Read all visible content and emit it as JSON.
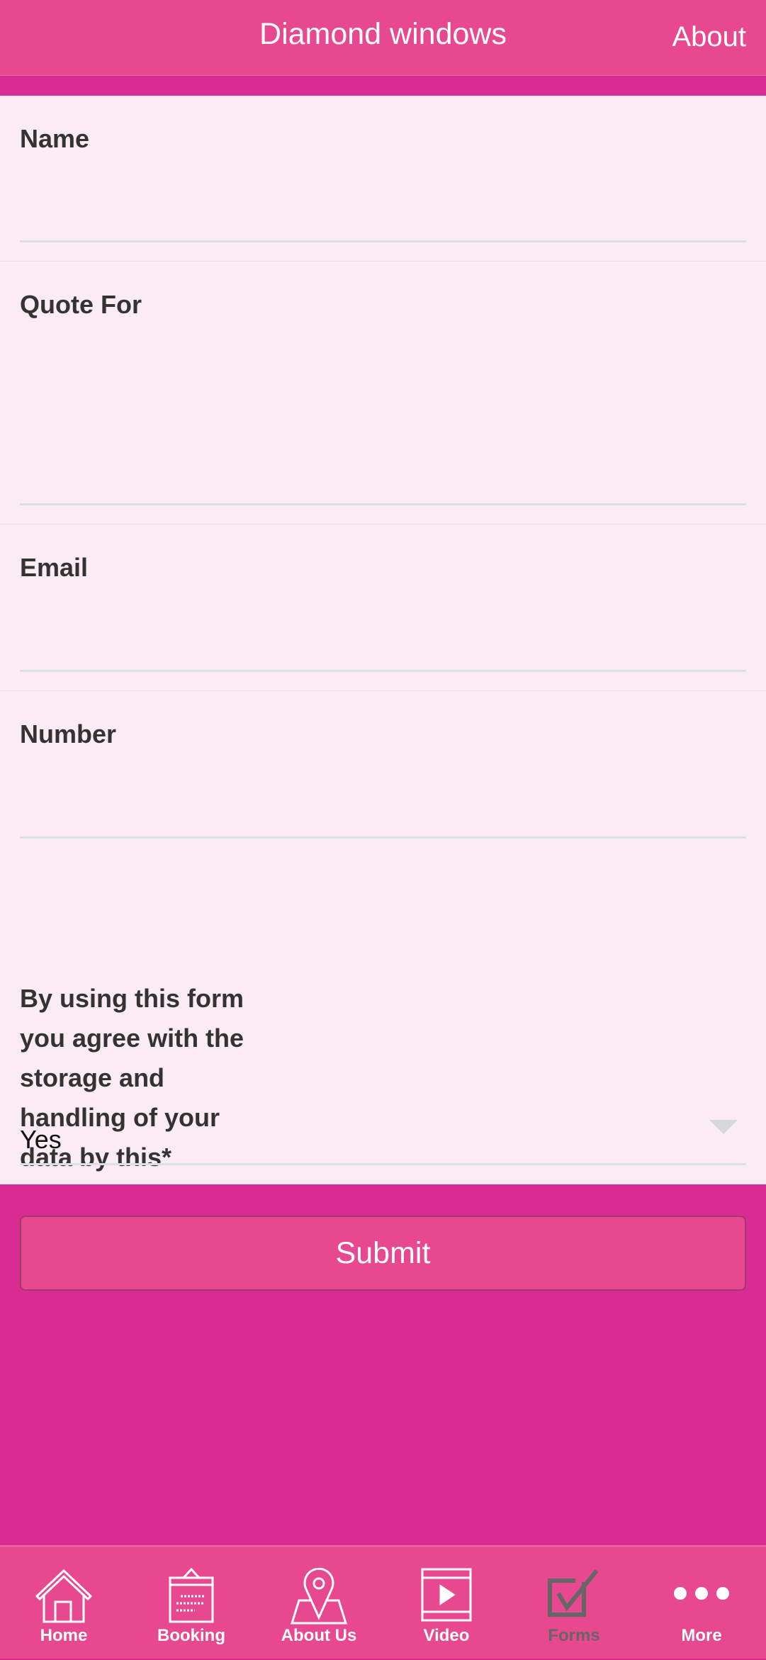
{
  "header": {
    "title": "Diamond windows",
    "about_label": "About"
  },
  "form": {
    "fields": [
      {
        "label": "Name",
        "value": ""
      },
      {
        "label": "Quote For",
        "value": ""
      },
      {
        "label": "Email",
        "value": ""
      },
      {
        "label": "Number",
        "value": ""
      }
    ],
    "consent_label": "By using this form you agree with the storage and handling of your data by this*",
    "consent_value": "Yes",
    "submit_label": "Submit"
  },
  "tabs": [
    {
      "label": "Home",
      "icon": "home-icon"
    },
    {
      "label": "Booking",
      "icon": "calendar-icon"
    },
    {
      "label": "About Us",
      "icon": "map-pin-icon"
    },
    {
      "label": "Video",
      "icon": "video-icon"
    },
    {
      "label": "Forms",
      "icon": "checkbox-icon",
      "active": true
    },
    {
      "label": "More",
      "icon": "more-icon"
    }
  ],
  "colors": {
    "header": "#e84890",
    "background": "#d82c93",
    "form": "#fbecf4",
    "active_tab": "#666666"
  }
}
